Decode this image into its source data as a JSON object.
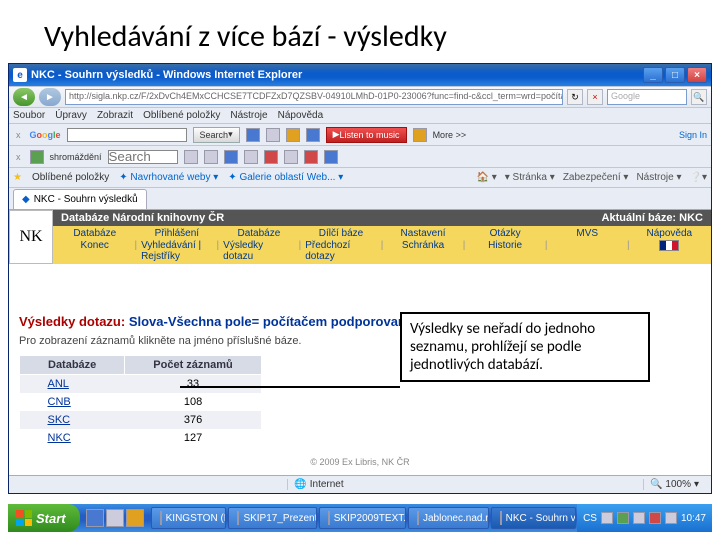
{
  "slide": {
    "title": "Vyhledávání z více bází - výsledky"
  },
  "window": {
    "title": "NKC - Souhrn výsledků - Windows Internet Explorer",
    "url": "http://sigla.nkp.cz/F/2xDvCh4EMxCCHCSE7TCDFZxD7QZSBV-04910LMhD-01P0-23006?func=find-c&ccl_term=wrd=počítač...",
    "search_placeholder": "Google"
  },
  "menus": [
    "Soubor",
    "Úpravy",
    "Zobrazit",
    "Oblíbené položky",
    "Nástroje",
    "Nápověda"
  ],
  "google_bar": {
    "brand": "Google",
    "search_label": "Search",
    "more": "More >>",
    "signin": "Sign In",
    "listen": "Listen to music"
  },
  "extra_bar": {
    "label": "shromáždění",
    "field": "Search"
  },
  "favbar": {
    "fav": "Oblíbené položky",
    "sites": "Navrhované weby",
    "gallery": "Galerie oblastí Web...",
    "tools": [
      "Domů",
      "Stránka",
      "Zabezpečení",
      "Nástroje"
    ]
  },
  "tab": "NKC - Souhrn výsledků",
  "nk": {
    "title": "Databáze Národní knihovny ČR",
    "current": "Aktuální báze:  NKC",
    "menu": [
      [
        "Databáze",
        "Přihlášení",
        "Databáze",
        "Dílčí báze",
        "Nastavení",
        "Otázky",
        "MVS",
        "Nápověda"
      ],
      [
        "Konec",
        "Vyhledávání | Rejstříky",
        "Výsledky dotazu",
        "Předchozí dotazy",
        "Schránka",
        "Historie",
        "",
        ""
      ]
    ]
  },
  "results": {
    "label": "Výsledky dotazu:",
    "query": "Slova-Všechna pole= počítačem podporovaná výuka",
    "hint": "Pro zobrazení záznamů klikněte na jméno příslušné báze.",
    "cols": [
      "Databáze",
      "Počet záznamů"
    ],
    "rows": [
      {
        "db": "ANL",
        "count": "33"
      },
      {
        "db": "CNB",
        "count": "108"
      },
      {
        "db": "SKC",
        "count": "376"
      },
      {
        "db": "NKC",
        "count": "127"
      }
    ]
  },
  "copyright": "© 2009 Ex Libris, NK ČR",
  "callout": "Výsledky se neřadí do jednoho seznamu, prohlížejí se podle  jednotlivých databází.",
  "status": {
    "internet": "Internet",
    "zoom": "100%"
  },
  "taskbar": {
    "start": "Start",
    "tasks": [
      "KINGSTON (F:)",
      "SKIP17_Prezenta…",
      "SKIP2009TEXT.d…",
      "Jablonec.nad.n…",
      "NKC - Souhrn vý…"
    ],
    "time": "10:47",
    "tray_text": "CS"
  }
}
